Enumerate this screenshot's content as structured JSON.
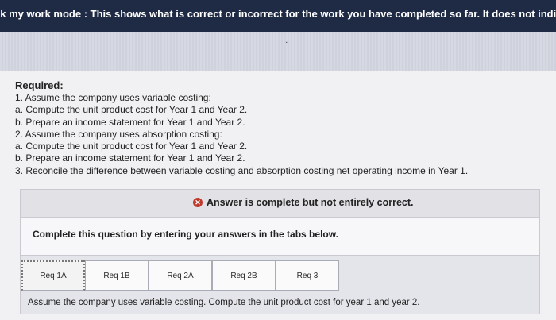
{
  "top_bar": {
    "text": "ck my work mode : This shows what is correct or incorrect for the work you have completed so far. It does not indi"
  },
  "banner": {
    "mark": "˙"
  },
  "requirements": {
    "title": "Required:",
    "items": [
      "1. Assume the company uses variable costing:",
      "a. Compute the unit product cost for Year 1 and Year 2.",
      "b. Prepare an income statement for Year 1 and Year 2.",
      "2. Assume the company uses absorption costing:",
      "a. Compute the unit product cost for Year 1 and Year 2.",
      "b. Prepare an income statement for Year 1 and Year 2.",
      "3. Reconcile the difference between variable costing and absorption costing net operating income in Year 1."
    ]
  },
  "status": {
    "icon": "x-circle-icon",
    "text": "Answer is complete but not entirely correct."
  },
  "instructions": {
    "text": "Complete this question by entering your answers in the tabs below."
  },
  "tabs": [
    {
      "label": "Req 1A",
      "active": true
    },
    {
      "label": "Req 1B",
      "active": false
    },
    {
      "label": "Req 2A",
      "active": false
    },
    {
      "label": "Req 2B",
      "active": false
    },
    {
      "label": "Req 3",
      "active": false
    }
  ],
  "tab_content": {
    "text": "Assume the company uses variable costing. Compute the unit product cost for year 1 and year 2."
  },
  "colors": {
    "top_bar": "#1f2a44",
    "status_icon": "#c0392b"
  }
}
